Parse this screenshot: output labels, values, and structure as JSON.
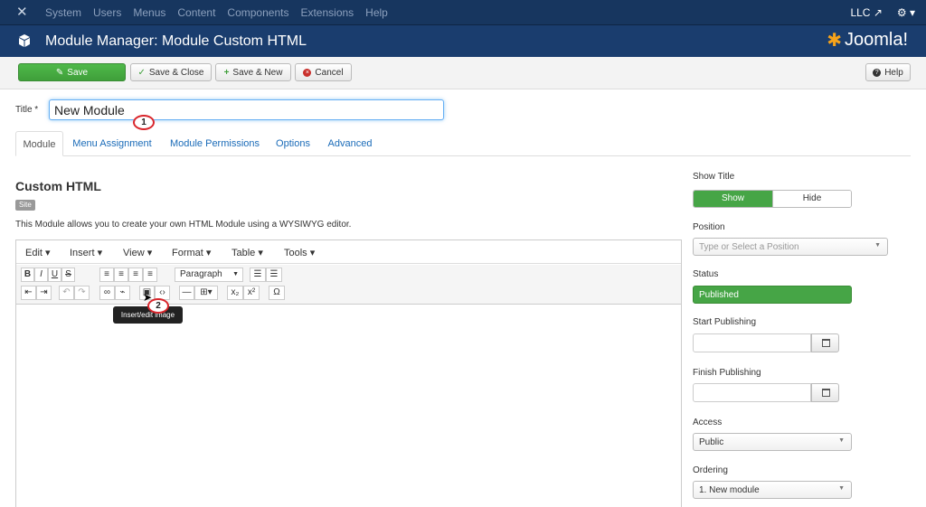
{
  "topnav": {
    "menu": [
      "System",
      "Users",
      "Menus",
      "Content",
      "Components",
      "Extensions",
      "Help"
    ],
    "site_link": "LLC",
    "user_menu": "⚙ ▾"
  },
  "header": {
    "title": "Module Manager: Module Custom HTML",
    "brand": "Joomla!"
  },
  "toolbar": {
    "save": "Save",
    "save_close": "Save & Close",
    "save_new": "Save & New",
    "cancel": "Cancel",
    "help": "Help"
  },
  "form": {
    "title_label": "Title *",
    "title_value": "New Module",
    "callout_1": "1",
    "callout_2": "2"
  },
  "tabs": [
    "Module",
    "Menu Assignment",
    "Module Permissions",
    "Options",
    "Advanced"
  ],
  "module": {
    "heading": "Custom HTML",
    "badge": "Site",
    "description": "This Module allows you to create your own HTML Module using a WYSIWYG editor."
  },
  "editor": {
    "menus": [
      "Edit ▾",
      "Insert ▾",
      "View ▾",
      "Format ▾",
      "Table ▾",
      "Tools ▾"
    ],
    "format_select": "Paragraph",
    "tooltip": "Insert/edit image"
  },
  "sidebar": {
    "show_title_label": "Show Title",
    "show": "Show",
    "hide": "Hide",
    "position_label": "Position",
    "position_placeholder": "Type or Select a Position",
    "status_label": "Status",
    "status_value": "Published",
    "start_label": "Start Publishing",
    "finish_label": "Finish Publishing",
    "access_label": "Access",
    "access_value": "Public",
    "ordering_label": "Ordering",
    "ordering_value": "1. New module"
  },
  "colors": {
    "topnav_bg": "#17365f",
    "header_bg": "#1a3d6e",
    "save_green": "#46a546",
    "link_blue": "#1a6bb8",
    "callout_red": "#d9262c"
  }
}
